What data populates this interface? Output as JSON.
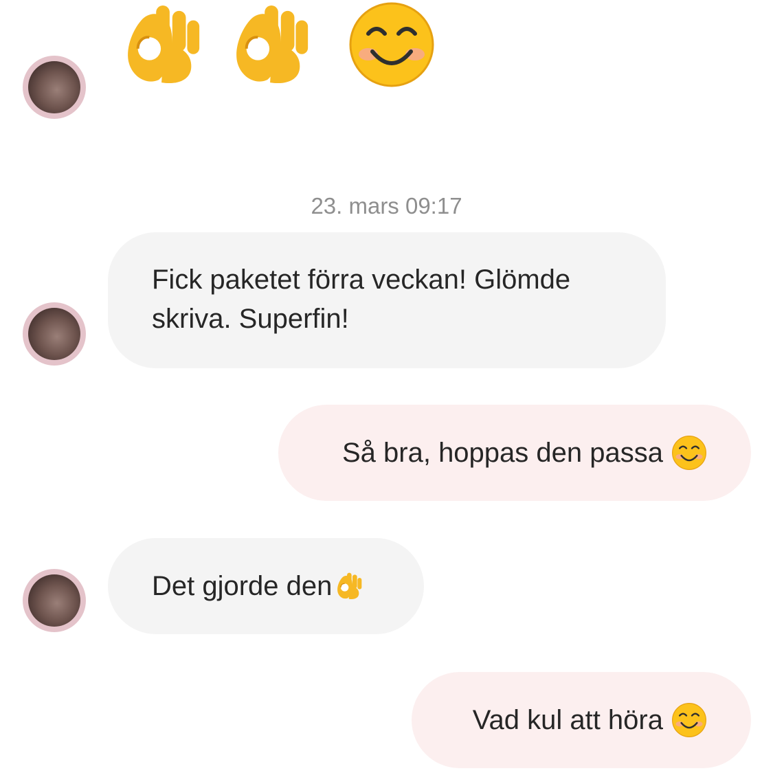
{
  "chat": {
    "top_reaction": {
      "emojis": [
        "ok-hand-emoji",
        "ok-hand-emoji",
        "smiling-face-emoji"
      ]
    },
    "timestamp": "23. mars 09:17",
    "messages": [
      {
        "direction": "incoming",
        "line1": "Fick paketet förra veckan! Glömde",
        "line2": "skriva. Superfin!"
      },
      {
        "direction": "outgoing",
        "text": "Så bra, hoppas den passa",
        "emoji": "smiling-face-emoji"
      },
      {
        "direction": "incoming",
        "text": "Det gjorde den",
        "emoji": "ok-hand-emoji"
      },
      {
        "direction": "outgoing",
        "text": "Vad kul att höra",
        "emoji": "smiling-face-emoji"
      }
    ]
  },
  "colors": {
    "incoming_bubble": "#f4f4f4",
    "outgoing_bubble": "#fcefef",
    "timestamp_text": "#8e8e8e",
    "message_text": "#262626"
  }
}
